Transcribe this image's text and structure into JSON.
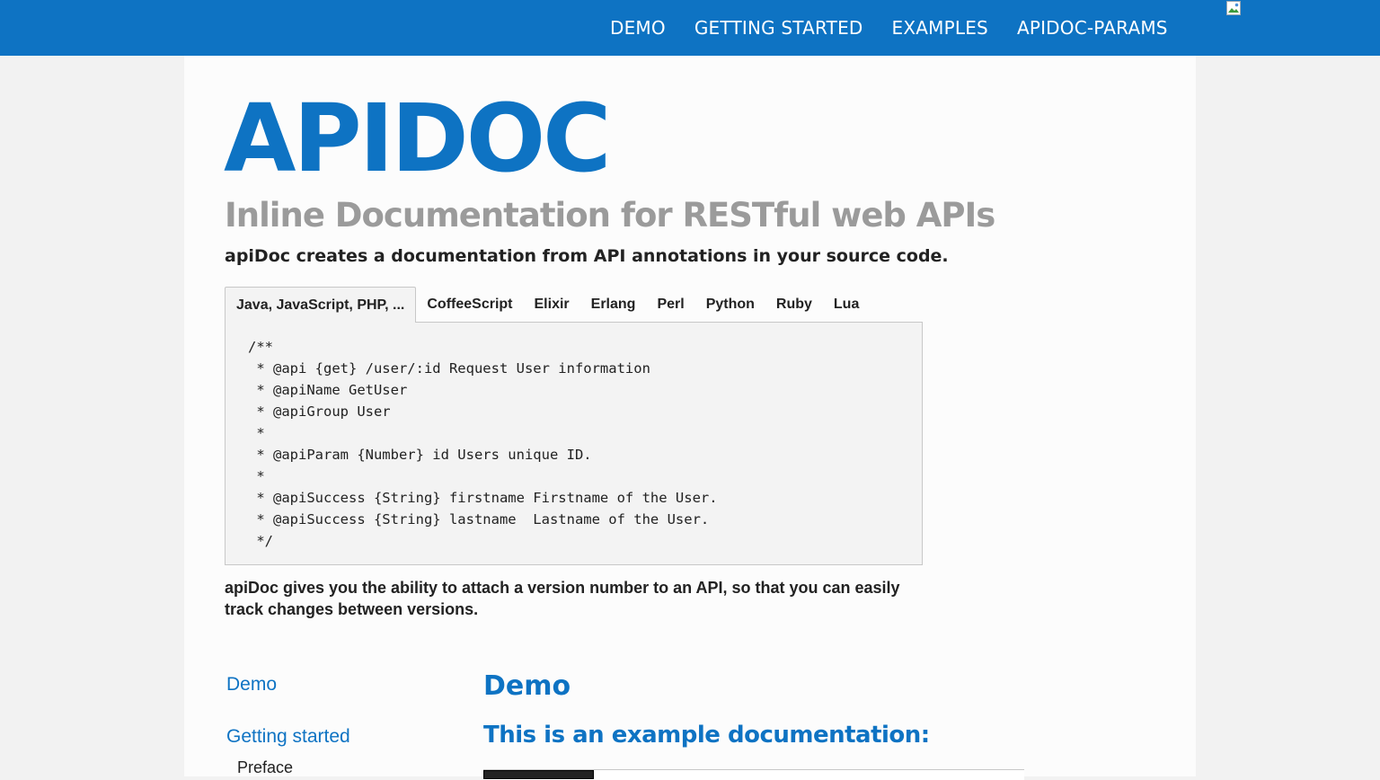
{
  "nav": {
    "items": [
      {
        "label": "DEMO"
      },
      {
        "label": "GETTING STARTED"
      },
      {
        "label": "EXAMPLES"
      },
      {
        "label": "APIDOC-PARAMS"
      }
    ]
  },
  "hero": {
    "title": "APIDOC",
    "subtitle": "Inline Documentation for RESTful web APIs",
    "description": "apiDoc creates a documentation from API annotations in your source code."
  },
  "code_tabs": {
    "tabs": [
      {
        "label": "Java, JavaScript, PHP, ..."
      },
      {
        "label": "CoffeeScript"
      },
      {
        "label": "Elixir"
      },
      {
        "label": "Erlang"
      },
      {
        "label": "Perl"
      },
      {
        "label": "Python"
      },
      {
        "label": "Ruby"
      },
      {
        "label": "Lua"
      }
    ],
    "active_index": 0,
    "code": "/**\n * @api {get} /user/:id Request User information\n * @apiName GetUser\n * @apiGroup User\n *\n * @apiParam {Number} id Users unique ID.\n *\n * @apiSuccess {String} firstname Firstname of the User.\n * @apiSuccess {String} lastname  Lastname of the User.\n */"
  },
  "version_text": "apiDoc gives you the ability to attach a version number to an API, so that you can easily track changes between versions.",
  "sidenav": {
    "demo": "Demo",
    "getting_started": "Getting started",
    "preface": "Preface"
  },
  "main": {
    "heading": "Demo",
    "subheading": "This is an example documentation:"
  },
  "colors": {
    "brand": "#0e73c3",
    "subtitle_gray": "#9b9b9b",
    "text": "#222222"
  }
}
